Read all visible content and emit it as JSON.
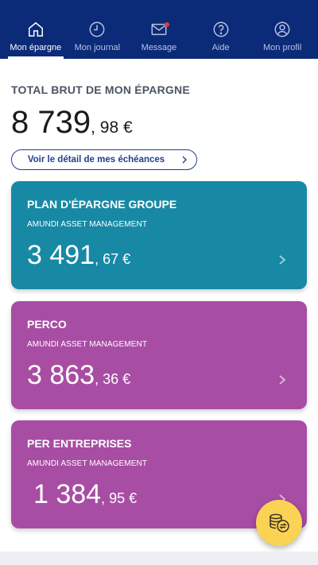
{
  "nav": {
    "items": [
      {
        "label": "Mon épargne",
        "icon": "home-icon",
        "active": true
      },
      {
        "label": "Mon journal",
        "icon": "clock-icon",
        "active": false
      },
      {
        "label": "Message",
        "icon": "mail-icon",
        "active": false
      },
      {
        "label": "Aide",
        "icon": "help-icon",
        "active": false
      },
      {
        "label": "Mon profil",
        "icon": "user-icon",
        "active": false
      }
    ]
  },
  "summary": {
    "title": "TOTAL BRUT DE MON ÉPARGNE",
    "amount_int": "8 739",
    "amount_dec": ", 98 €",
    "details_label": "Voir le détail de mes échéances"
  },
  "plans": [
    {
      "name": "PLAN D'ÉPARGNE GROUPE",
      "manager": "AMUNDI ASSET MANAGEMENT",
      "amount_int": "3 491",
      "amount_dec": ", 67 €",
      "color": "#1789a5"
    },
    {
      "name": "PERCO",
      "manager": "AMUNDI ASSET MANAGEMENT",
      "amount_int": "3 863",
      "amount_dec": ", 36 €",
      "color": "#a84da4"
    },
    {
      "name": "PER ENTREPRISES",
      "manager": "AMUNDI ASSET MANAGEMENT",
      "amount_int": "1 384",
      "amount_dec": ", 95 €",
      "color": "#a84da4"
    }
  ],
  "fab": {
    "icon": "coins-exchange-icon",
    "color": "#fbd354"
  },
  "colors": {
    "nav_background": "#0b2a78",
    "notification": "#e53935"
  }
}
